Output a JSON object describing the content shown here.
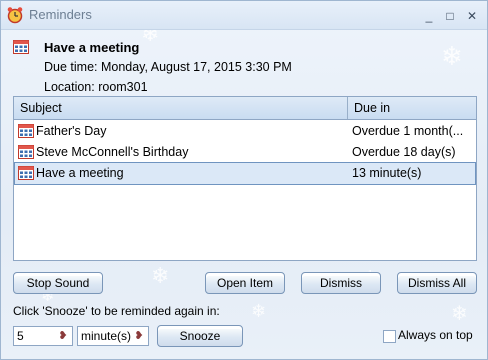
{
  "window": {
    "title": "Reminders"
  },
  "titlebar": {
    "minimize": "_",
    "maximize": "□",
    "close": "✕"
  },
  "reminder": {
    "title": "Have a meeting",
    "due_time": "Due time: Monday, August 17, 2015 3:30 PM",
    "location": "Location: room301"
  },
  "list": {
    "columns": [
      "Subject",
      "Due in"
    ],
    "rows": [
      {
        "subject": "Father's Day",
        "due": "Overdue 1 month(..."
      },
      {
        "subject": "Steve McConnell's Birthday",
        "due": "Overdue 18 day(s)"
      },
      {
        "subject": "Have a meeting",
        "due": "13 minute(s)",
        "selected": true
      }
    ]
  },
  "buttons": {
    "stop_sound": "Stop Sound",
    "open_item": "Open Item",
    "dismiss": "Dismiss",
    "dismiss_all": "Dismiss All",
    "snooze": "Snooze"
  },
  "snooze": {
    "label": "Click 'Snooze' to be reminded again in:",
    "amount": "5",
    "unit": "minute(s)"
  },
  "always_on_top": {
    "label": "Always on top",
    "checked": false
  },
  "colors": {
    "accent": "#6f94c0",
    "selection": "#dbe8f7",
    "window_bg": "#e6eef8"
  },
  "icons": [
    "alarm-clock-icon",
    "calendar-icon",
    "heart-dropdown-icon"
  ]
}
